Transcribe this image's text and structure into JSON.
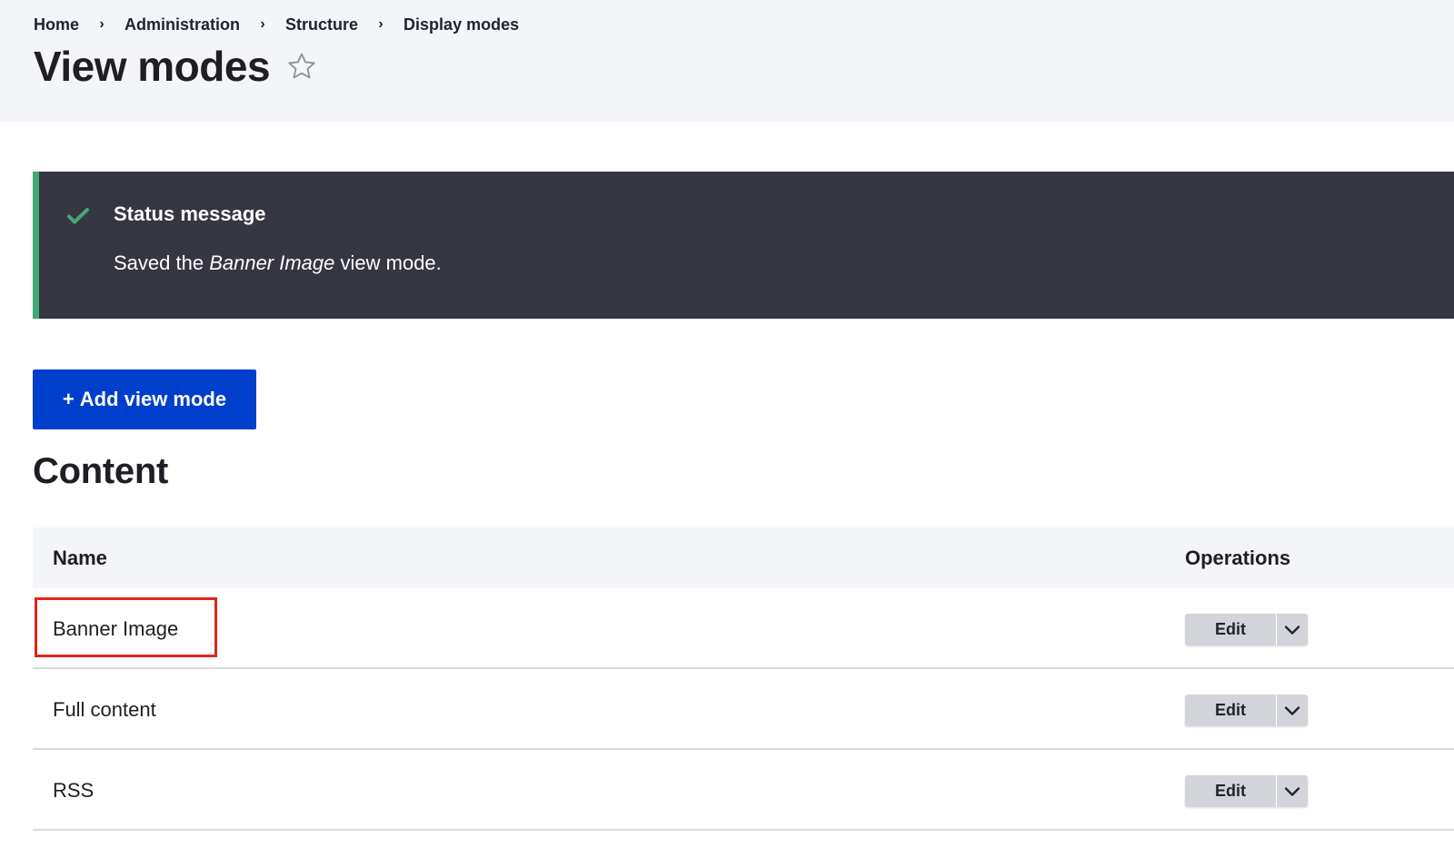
{
  "breadcrumb": {
    "items": [
      "Home",
      "Administration",
      "Structure",
      "Display modes"
    ],
    "separator": "›"
  },
  "page": {
    "title": "View modes"
  },
  "status": {
    "title": "Status message",
    "text_prefix": "Saved the ",
    "text_emphasis": "Banner Image",
    "text_suffix": " view mode.",
    "accent_color": "#42a877",
    "background_color": "#353641"
  },
  "add_button": {
    "plus": "+",
    "label": "Add view mode",
    "color": "#003ecc"
  },
  "section": {
    "title": "Content"
  },
  "table": {
    "columns": [
      "Name",
      "Operations"
    ],
    "rows": [
      {
        "name": "Banner Image",
        "operation": "Edit"
      },
      {
        "name": "Full content",
        "operation": "Edit"
      },
      {
        "name": "RSS",
        "operation": "Edit"
      }
    ]
  },
  "icons": {
    "star": "star-outline-icon",
    "check": "check-icon",
    "dropdown": "chevron-down-icon"
  }
}
